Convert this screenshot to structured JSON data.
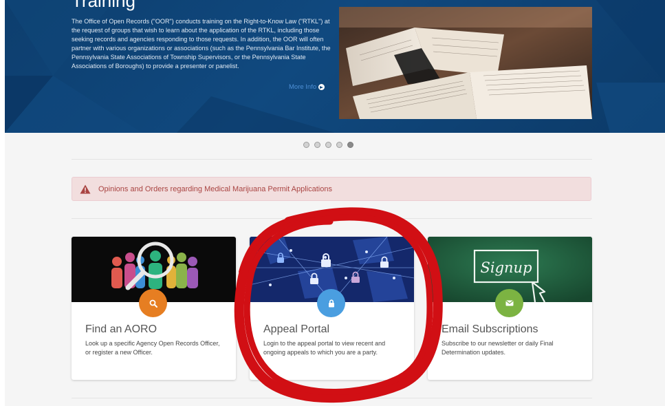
{
  "hero": {
    "title": "Training",
    "description": "The Office of Open Records (\"OOR\") conducts training on the Right-to-Know Law (\"RTKL\") at the request of groups that wish to learn about the application of the RTKL, including those seeking records and agencies responding to those requests. In addition, the OOR will often partner with various organizations or associations (such as the Pennsylvania Bar Institute, the Pennsylvania State Associations of Township Supervisors, or the Pennsylvania State Associations of Boroughs) to provide a presenter or panelist.",
    "more_link": "More Info",
    "more_icon": "arrow-circle-right-icon",
    "image": "open-books-photo"
  },
  "carousel": {
    "slide_count": 5,
    "active_slide": 5
  },
  "alert": {
    "icon": "warning-triangle-icon",
    "text": "Opinions and Orders regarding Medical Marijuana Permit Applications"
  },
  "cards": [
    {
      "title": "Find an AORO",
      "description": "Look up a specific Agency Open Records Officer, or register a new Officer.",
      "icon": "search-icon",
      "icon_color": "#e67e22",
      "image": "people-magnifier-illustration"
    },
    {
      "title": "Appeal Portal",
      "description": "Login to the appeal portal to view recent and ongoing appeals to which you are a party.",
      "icon": "lock-icon",
      "icon_color": "#4a9ee0",
      "image": "network-locks-illustration"
    },
    {
      "title": "Email Subscriptions",
      "description": "Subscribe to our newsletter or daily Final Determination updates.",
      "icon": "envelope-icon",
      "icon_color": "#7cb342",
      "image": "chalkboard-signup",
      "image_text": "Signup"
    }
  ],
  "colors": {
    "hero_bg": "#10497f",
    "alert_bg": "#f2dede",
    "alert_text": "#a94442",
    "annotation": "#d10f14"
  }
}
